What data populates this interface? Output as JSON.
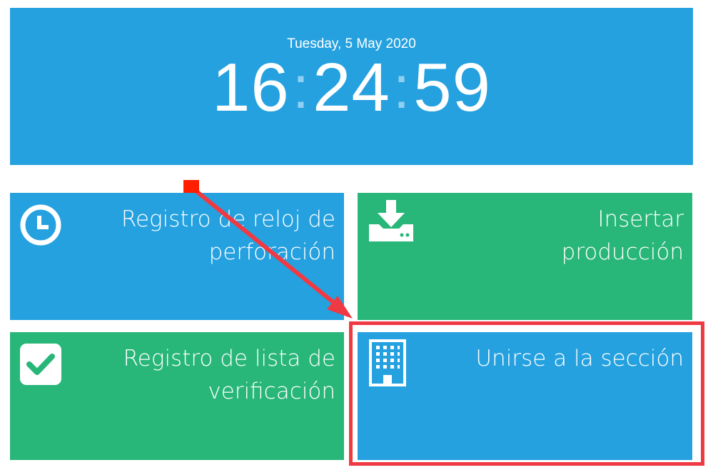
{
  "clock": {
    "date": "Tuesday, 5 May 2020",
    "hours": "16",
    "minutes": "24",
    "seconds": "59",
    "separator": ":"
  },
  "tiles": [
    {
      "label_line1": "Registro de reloj de",
      "label_line2": "perforación",
      "icon": "clock-icon",
      "color": "#25a1e0"
    },
    {
      "label_line1": "Insertar",
      "label_line2": "producción",
      "icon": "download-icon",
      "color": "#28b779"
    },
    {
      "label_line1": "Registro de lista de",
      "label_line2": "verificación",
      "icon": "checkbox-icon",
      "color": "#28b779"
    },
    {
      "label_line1": "Unirse a la sección",
      "label_line2": "",
      "icon": "building-icon",
      "color": "#25a1e0"
    }
  ],
  "annotation": {
    "highlight_color": "#f03a43",
    "arrow_color": "#f03a43",
    "marker_color": "#ff1e00"
  }
}
